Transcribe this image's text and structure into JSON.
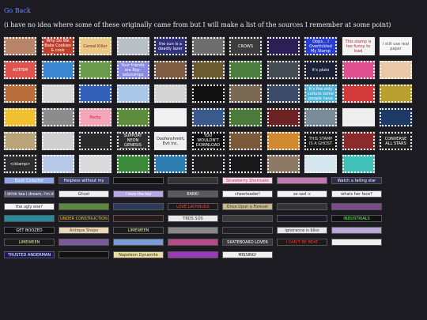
{
  "nav": {
    "back_label": "Go Back"
  },
  "intro": "(i have no idea where some of these originally came from but I will make a list of the sources I remember at some point)",
  "stamps": [
    {
      "text": "",
      "bg": "#b8856a",
      "fg": "#ffffff"
    },
    {
      "text": "Why Do We Bake Cookies & cook Bacon?",
      "bg": "#c0402e",
      "fg": "#ffffff"
    },
    {
      "text": "Cereal Killer",
      "bg": "#e9c987",
      "fg": "#8a1e12"
    },
    {
      "text": "",
      "bg": "#b9bfc6",
      "fg": "#ffffff"
    },
    {
      "text": "the sun is a deadly lazer",
      "bg": "#31307a",
      "fg": "#ffffff"
    },
    {
      "text": "",
      "bg": "#6e6e6e",
      "fg": "#ffffff"
    },
    {
      "text": "CROWS",
      "bg": "#3d3d3d",
      "fg": "#ffffff"
    },
    {
      "text": "",
      "bg": "#2b1f55",
      "fg": "#ffffff"
    },
    {
      "text": "Oops... I Overtickled My Stamp",
      "bg": "#2a3fd0",
      "fg": "#ffffff"
    },
    {
      "text": "This stamp is too funny to load",
      "bg": "#f3f3f3",
      "fg": "#c0202a"
    },
    {
      "text": "I still use real paper",
      "bg": "#f6f6f6",
      "fg": "#555555"
    },
    {
      "text": "AUTISM",
      "bg": "#e0524d",
      "fg": "#ffffff"
    },
    {
      "text": "",
      "bg": "#3a86d1",
      "fg": "#ffffff"
    },
    {
      "text": "",
      "bg": "#6a9a4b",
      "fg": "#ffffff"
    },
    {
      "text": "Your friends are Roy-lationships",
      "bg": "#8a8ae0",
      "fg": "#ffffff"
    },
    {
      "text": "",
      "bg": "#7e5c42",
      "fg": "#ffffff"
    },
    {
      "text": "",
      "bg": "#6b5a2e",
      "fg": "#ffffff"
    },
    {
      "text": "",
      "bg": "#4a7d3e",
      "fg": "#ffffff"
    },
    {
      "text": "",
      "bg": "#444a52",
      "fg": "#ffffff"
    },
    {
      "text": "it's pluto",
      "bg": "#1d2238",
      "fg": "#ffffff"
    },
    {
      "text": "",
      "bg": "#e04f8f",
      "fg": "#ffffff"
    },
    {
      "text": "",
      "bg": "#e8c8a8",
      "fg": "#ffffff"
    },
    {
      "text": "",
      "bg": "#b86f3a",
      "fg": "#ffffff"
    },
    {
      "text": "",
      "bg": "#d8d8d8",
      "fg": "#ffffff"
    },
    {
      "text": "",
      "bg": "#3360b8",
      "fg": "#ffffff"
    },
    {
      "text": "",
      "bg": "#a9c7e8",
      "fg": "#ffffff"
    },
    {
      "text": "",
      "bg": "#d4d4d4",
      "fg": "#ffffff"
    },
    {
      "text": "",
      "bg": "#111111",
      "fg": "#ffffff"
    },
    {
      "text": "",
      "bg": "#7a6a55",
      "fg": "#ffffff"
    },
    {
      "text": "",
      "bg": "#3b4a66",
      "fg": "#ffffff"
    },
    {
      "text": "It's the only culture some people have",
      "bg": "#4fb4d8",
      "fg": "#ffffff"
    },
    {
      "text": "",
      "bg": "#d23a3a",
      "fg": "#ffffff"
    },
    {
      "text": "",
      "bg": "#b8a030",
      "fg": "#ffffff"
    },
    {
      "text": "",
      "bg": "#f0c030",
      "fg": "#ffffff"
    },
    {
      "text": "",
      "bg": "#8c8c8c",
      "fg": "#ffffff"
    },
    {
      "text": "Pocky",
      "bg": "#f2a6b8",
      "fg": "#c2173e"
    },
    {
      "text": "",
      "bg": "#5e8c3d",
      "fg": "#ffffff"
    },
    {
      "text": "",
      "bg": "#f1f1f1",
      "fg": "#ffffff"
    },
    {
      "text": "",
      "bg": "#3a5a8c",
      "fg": "#ffffff"
    },
    {
      "text": "",
      "bg": "#4c7a3a",
      "fg": "#ffffff"
    },
    {
      "text": "",
      "bg": "#6b2222",
      "fg": "#ffffff"
    },
    {
      "text": "",
      "bg": "#7a8c99",
      "fg": "#ffffff"
    },
    {
      "text": "",
      "bg": "#eeeeee",
      "fg": "#ffffff"
    },
    {
      "text": "",
      "bg": "#1d3a66",
      "fg": "#ffffff"
    },
    {
      "text": "",
      "bg": "#b9a47a",
      "fg": "#ffffff"
    },
    {
      "text": "",
      "bg": "#cfcfcf",
      "fg": "#ffffff"
    },
    {
      "text": "",
      "bg": "#2a2a2a",
      "fg": "#ffffff"
    },
    {
      "text": "SUPPORT NEON GENESIS EVANGELION",
      "bg": "#2e2e2e",
      "fg": "#ffffff"
    },
    {
      "text": "Doofenshmirtz Evil Inc.",
      "bg": "#eeeeee",
      "fg": "#222222"
    },
    {
      "text": "YOU WOULDN'T DOWNLOAD A CAR",
      "bg": "#111111",
      "fg": "#ffffff"
    },
    {
      "text": "",
      "bg": "#7a5a3a",
      "fg": "#ffffff"
    },
    {
      "text": "",
      "bg": "#d18a30",
      "fg": "#ffffff"
    },
    {
      "text": "THIS STAMP IS A GHOST",
      "bg": "#1a1a1a",
      "fg": "#dddddd"
    },
    {
      "text": "",
      "bg": "#8a2a2a",
      "fg": "#ffffff"
    },
    {
      "text": "CONVERSE ALL STARS",
      "bg": "#222222",
      "fg": "#ffffff"
    },
    {
      "text": "</stamp>",
      "bg": "#2d2d2d",
      "fg": "#ffffff"
    },
    {
      "text": "",
      "bg": "#b8c8e8",
      "fg": "#ffffff"
    },
    {
      "text": "",
      "bg": "#dadada",
      "fg": "#ffffff"
    },
    {
      "text": "",
      "bg": "#3b8a3b",
      "fg": "#ffffff"
    },
    {
      "text": "",
      "bg": "#2d7db0",
      "fg": "#ffffff"
    },
    {
      "text": "",
      "bg": "#1e1e1e",
      "fg": "#ffffff"
    },
    {
      "text": "",
      "bg": "#181818",
      "fg": "#ffffff"
    },
    {
      "text": "",
      "bg": "#8d7a66",
      "fg": "#ffffff"
    },
    {
      "text": "",
      "bg": "#d6e6ee",
      "fg": "#ffffff"
    },
    {
      "text": "",
      "bg": "#42c1b8",
      "fg": "#ffffff"
    }
  ],
  "blinkies": [
    {
      "text": "Book Collector",
      "bg": "#8fa8e8",
      "fg": "#ffffff"
    },
    {
      "text": "Helpless without my",
      "bg": "#3a3a66",
      "fg": "#ffffff"
    },
    {
      "text": "",
      "bg": "#111111",
      "fg": "#ffffff"
    },
    {
      "text": "",
      "bg": "#333333",
      "fg": "#ffffff"
    },
    {
      "text": "Strawberry Shortcake",
      "bg": "#ffd6e8",
      "fg": "#c03a6a"
    },
    {
      "text": "",
      "bg": "#c07ab0",
      "fg": "#ffffff"
    },
    {
      "text": "Watch a falling star",
      "bg": "#2a2a4a",
      "fg": "#ffffff"
    },
    {
      "text": "I drink tea i dream, i'm dreaming",
      "bg": "#5a5a7a",
      "fg": "#ffffff"
    },
    {
      "text": "Ghost",
      "bg": "#f0f0f0",
      "fg": "#333333"
    },
    {
      "text": "I love the toy",
      "bg": "#b8a8e8",
      "fg": "#ffffff"
    },
    {
      "text": "EARK!",
      "bg": "#5a5a5a",
      "fg": "#ffffff"
    },
    {
      "text": "cheerleader!",
      "bg": "#f4f4f4",
      "fg": "#222222"
    },
    {
      "text": "so sad :c",
      "bg": "#f4f4f4",
      "fg": "#222222"
    },
    {
      "text": "whats her face?",
      "bg": "#f4f4f4",
      "fg": "#222222"
    },
    {
      "text": "the ugly one?",
      "bg": "#f4f4f4",
      "fg": "#222222"
    },
    {
      "text": "",
      "bg": "#5a8a3a",
      "fg": "#ffffff"
    },
    {
      "text": "",
      "bg": "#2a3a5a",
      "fg": "#ffffff"
    },
    {
      "text": "LOVE LADYBUGS",
      "bg": "#1a1a1a",
      "fg": "#ff4444"
    },
    {
      "text": "Once Upon a Forever",
      "bg": "#c8b88a",
      "fg": "#333333"
    },
    {
      "text": "",
      "bg": "#333333",
      "fg": "#ffffff"
    },
    {
      "text": "",
      "bg": "#7a4a8a",
      "fg": "#ffffff"
    },
    {
      "text": "",
      "bg": "#2a8a9a",
      "fg": "#ffffff"
    },
    {
      "text": "UNDER CONSTRUCTION",
      "bg": "#222222",
      "fg": "#f0c030"
    },
    {
      "text": "",
      "bg": "#2a1a1a",
      "fg": "#ff6a6a"
    },
    {
      "text": "TRDS SOS",
      "bg": "#e8e8e8",
      "fg": "#333333"
    },
    {
      "text": "",
      "bg": "#3a3a3a",
      "fg": "#ffffff"
    },
    {
      "text": "",
      "bg": "#1a1a2a",
      "fg": "#ffffff"
    },
    {
      "text": "INDUSTRIALS",
      "bg": "#111111",
      "fg": "#66ff66"
    },
    {
      "text": "GET BOOZED",
      "bg": "#111111",
      "fg": "#ffffff"
    },
    {
      "text": "Antique Shops",
      "bg": "#e8d8b8",
      "fg": "#5a3a1a"
    },
    {
      "text": "LIMEWEEN",
      "bg": "#1a1a1a",
      "fg": "#d8f0a8"
    },
    {
      "text": "",
      "bg": "#888888",
      "fg": "#ffffff"
    },
    {
      "text": "",
      "bg": "#222222",
      "fg": "#ffffff"
    },
    {
      "text": "ignorance is bliss",
      "bg": "#e8e8e8",
      "fg": "#333333"
    },
    {
      "text": "",
      "bg": "#b8a8d8",
      "fg": "#ffffff"
    },
    {
      "text": "LIMEWEEN",
      "bg": "#1a1a1a",
      "fg": "#d8f0a8"
    },
    {
      "text": "",
      "bg": "#7a5a9a",
      "fg": "#ffffff"
    },
    {
      "text": "",
      "bg": "#7a9ad8",
      "fg": "#ffffff"
    },
    {
      "text": "",
      "bg": "#b84a8a",
      "fg": "#ffffff"
    },
    {
      "text": "SKATEBOARD LOVER",
      "bg": "#3a3a3a",
      "fg": "#ffffff"
    },
    {
      "text": "I CAN'T BE BEAT",
      "bg": "#1a1a1a",
      "fg": "#ff3030"
    },
    {
      "text": "",
      "bg": "#f0f0f0",
      "fg": "#111111"
    },
    {
      "text": "TRUSTED ANDERMAN",
      "bg": "#1a1a5a",
      "fg": "#ffffff"
    },
    {
      "text": "",
      "bg": "#111111",
      "fg": "#ffffff"
    },
    {
      "text": "Napoleon Dynamite",
      "bg": "#e8e0a0",
      "fg": "#3a2a1a"
    },
    {
      "text": "",
      "bg": "#9a3ab8",
      "fg": "#ffffff"
    },
    {
      "text": "MISSING!",
      "bg": "#f0f0f0",
      "fg": "#111111"
    }
  ]
}
